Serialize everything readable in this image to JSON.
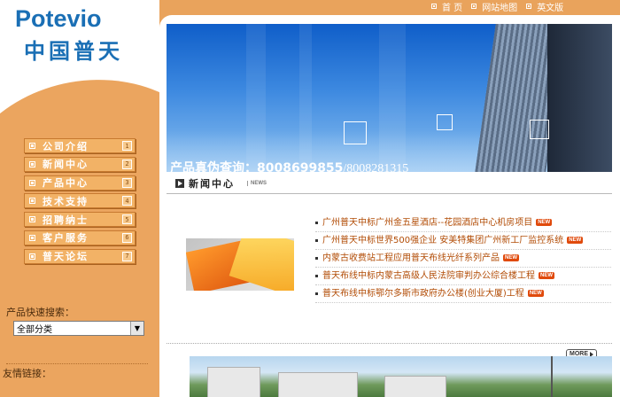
{
  "logo": {
    "latin": "Potevio",
    "chinese": "中国普天"
  },
  "top_links": [
    {
      "label": "首 页"
    },
    {
      "label": "网站地图"
    },
    {
      "label": "英文版"
    }
  ],
  "nav": [
    {
      "label": "公司介绍",
      "num": "1"
    },
    {
      "label": "新闻中心",
      "num": "2"
    },
    {
      "label": "产品中心",
      "num": "3"
    },
    {
      "label": "技术支持",
      "num": "4"
    },
    {
      "label": "招聘纳士",
      "num": "5"
    },
    {
      "label": "客户服务",
      "num": "6"
    },
    {
      "label": "普天论坛",
      "num": "7"
    }
  ],
  "search": {
    "label": "产品快速搜索：",
    "selected": "全部分类"
  },
  "links": {
    "label": "友情链接："
  },
  "banner": {
    "prefix": "产品真伪查询：",
    "phone1": "8008699855",
    "phone2": "/8008281315"
  },
  "news": {
    "title": "新闻中心",
    "tag": "NEWS",
    "badge": "NEW",
    "items": [
      {
        "text": "广州普天中标广州金五星酒店--花园酒店中心机房项目"
      },
      {
        "text": "广州普天中标世界500强企业 安美特集团广州新工厂监控系统"
      },
      {
        "text": "内蒙古收费站工程应用普天布线光纤系列产品"
      },
      {
        "text": "普天布线中标内蒙古高级人民法院审判办公综合楼工程"
      },
      {
        "text": "普天布线中标鄂尔多斯市政府办公楼(创业大厦)工程"
      }
    ],
    "more": "MORE"
  },
  "colors": {
    "accent": "#eba55f",
    "brand": "#1a6fb5",
    "news_text": "#b24c06"
  }
}
